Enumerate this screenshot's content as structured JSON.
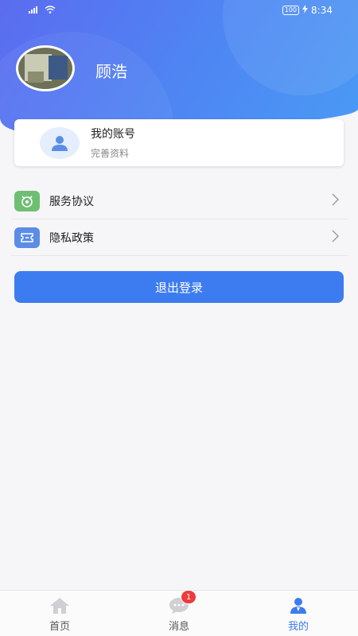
{
  "status_bar": {
    "time": "8:34",
    "battery": "100",
    "signal_icon": "signal-icon",
    "wifi_icon": "wifi-icon",
    "charging_icon": "charging-icon"
  },
  "profile": {
    "name": "顾浩",
    "avatar_icon": "user-photo"
  },
  "account_card": {
    "title": "我的账号",
    "subtitle": "完善资料",
    "icon": "user-icon"
  },
  "menu": [
    {
      "label": "服务协议",
      "icon": "agreement-icon",
      "icon_color": "#6fbf73"
    },
    {
      "label": "隐私政策",
      "icon": "privacy-ticket-icon",
      "icon_color": "#5b8de6"
    }
  ],
  "logout": {
    "label": "退出登录"
  },
  "bottom_nav": {
    "items": [
      {
        "label": "首页",
        "icon": "home-icon",
        "active": false
      },
      {
        "label": "消息",
        "icon": "message-icon",
        "active": false,
        "badge": "1"
      },
      {
        "label": "我的",
        "icon": "profile-icon",
        "active": true
      }
    ]
  },
  "colors": {
    "primary": "#3d7cf0",
    "header_start": "#5b6cf0",
    "header_end": "#4a9af5",
    "badge": "#ee3b3b"
  }
}
